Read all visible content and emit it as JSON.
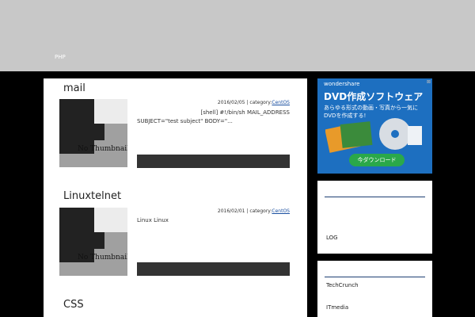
{
  "nav": {
    "php": "PHP"
  },
  "posts": [
    {
      "title": "mail",
      "date": "2016/02/05",
      "category_prefix": "| category:",
      "category": "CentOS",
      "excerpt_line1": "[shell] #!/bin/sh MAIL_ADDRESS",
      "excerpt_line2": "SUBJECT=\"test subject\" BODY=\"...",
      "thumb_text": "No Thumbnail"
    },
    {
      "title": "Linuxtelnet",
      "date": "2016/02/01",
      "category_prefix": "| category:",
      "category": "CentOS",
      "excerpt_line1": "Linux Linux",
      "thumb_text": "No Thumbnail"
    },
    {
      "title": "CSS"
    }
  ],
  "ad": {
    "brand": "wondershare",
    "title": "DVD作成ソフトウェア",
    "subtitle": "あらゆる形式の動画・写真から一気にDVDを作成する!",
    "download": "今ダウンロード",
    "close_icon": "ad-choices-icon"
  },
  "widgets": {
    "log_label": "LOG",
    "links": [
      "TechCrunch",
      "ITmedia"
    ]
  }
}
